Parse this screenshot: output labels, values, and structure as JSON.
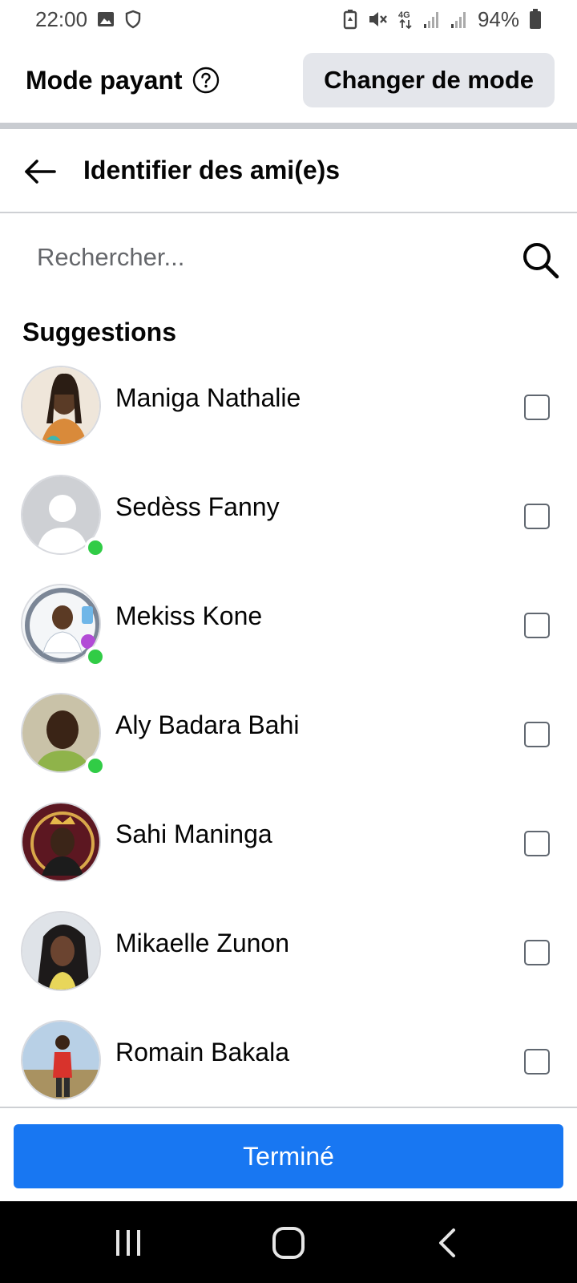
{
  "status_bar": {
    "time": "22:00",
    "battery_percent": "94%",
    "network": "4G",
    "icons_left": [
      "image-icon",
      "shield-icon"
    ],
    "icons_right": [
      "battery-saver-icon",
      "mute-icon",
      "network-4g-icon",
      "signal-icon",
      "signal-icon",
      "battery-icon"
    ]
  },
  "mode_header": {
    "title": "Mode payant",
    "help_icon": "question-circle-icon",
    "change_button": "Changer de mode"
  },
  "nav": {
    "back_icon": "arrow-left-icon",
    "title": "Identifier des ami(e)s"
  },
  "search": {
    "placeholder": "Rechercher...",
    "value": "",
    "icon": "search-icon"
  },
  "suggestions": {
    "title": "Suggestions",
    "friends": [
      {
        "name": "Maniga Nathalie",
        "online": false,
        "checked": false,
        "avatar_color": "#c8a27c"
      },
      {
        "name": "Sedèss Fanny",
        "online": true,
        "checked": false,
        "avatar_color": "#d8dadf"
      },
      {
        "name": "Mekiss Kone",
        "online": true,
        "checked": false,
        "avatar_color": "#b9c7d6"
      },
      {
        "name": "Aly Badara Bahi",
        "online": true,
        "checked": false,
        "avatar_color": "#8f7a55"
      },
      {
        "name": "Sahi Maninga",
        "online": false,
        "checked": false,
        "avatar_color": "#6b1f2a"
      },
      {
        "name": "Mikaelle Zunon",
        "online": false,
        "checked": false,
        "avatar_color": "#9aa4b0"
      },
      {
        "name": "Romain Bakala",
        "online": false,
        "checked": false,
        "avatar_color": "#8aa36a"
      }
    ]
  },
  "footer": {
    "done_button": "Terminé"
  },
  "colors": {
    "primary": "#1877f2",
    "online": "#31cc46",
    "secondary_button": "#e4e6eb"
  }
}
